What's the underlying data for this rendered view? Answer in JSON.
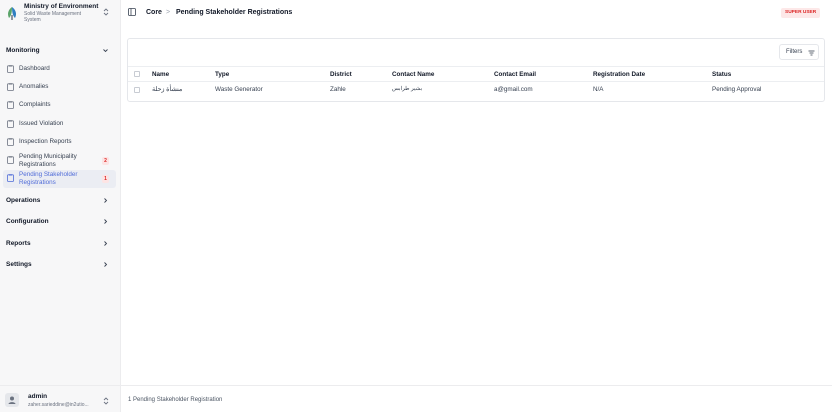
{
  "brand": {
    "title": "Ministry of Environment",
    "subtitle": "Solid Waste Management System"
  },
  "sidebar": {
    "sections": [
      {
        "label": "Monitoring",
        "expanded": true
      },
      {
        "label": "Operations",
        "expanded": false
      },
      {
        "label": "Configuration",
        "expanded": false
      },
      {
        "label": "Reports",
        "expanded": false
      },
      {
        "label": "Settings",
        "expanded": false
      }
    ],
    "items": [
      {
        "label": "Dashboard"
      },
      {
        "label": "Anomalies"
      },
      {
        "label": "Complaints"
      },
      {
        "label": "Issued Violation"
      },
      {
        "label": "Inspection Reports"
      },
      {
        "label": "Pending Municipality Registrations",
        "badge": "2"
      },
      {
        "label": "Pending Stakeholder Registrations",
        "badge": "1",
        "active": true
      }
    ]
  },
  "user": {
    "name": "admin",
    "email": "zaher.sarieddine@in2utio..."
  },
  "header": {
    "breadcrumb_root": "Core",
    "breadcrumb_sep": ">",
    "breadcrumb_current": "Pending Stakeholder Registrations",
    "role_badge": "SUPER USER"
  },
  "toolbar": {
    "filters_label": "Filters"
  },
  "table": {
    "columns": [
      "Name",
      "Type",
      "District",
      "Contact Name",
      "Contact Email",
      "Registration Date",
      "Status"
    ],
    "rows": [
      [
        "منشأة زحلة",
        "Waste Generator",
        "Zahle",
        "بشير طرابس",
        "a@gmail.com",
        "N/A",
        "Pending Approval"
      ]
    ]
  },
  "footer": {
    "summary": "1 Pending Stakeholder Registration"
  },
  "colors": {
    "accent": "#4f6bd8",
    "badge_red": "#dc2626",
    "badge_bg": "#fde4e4",
    "active_bg": "#ebedf3"
  }
}
